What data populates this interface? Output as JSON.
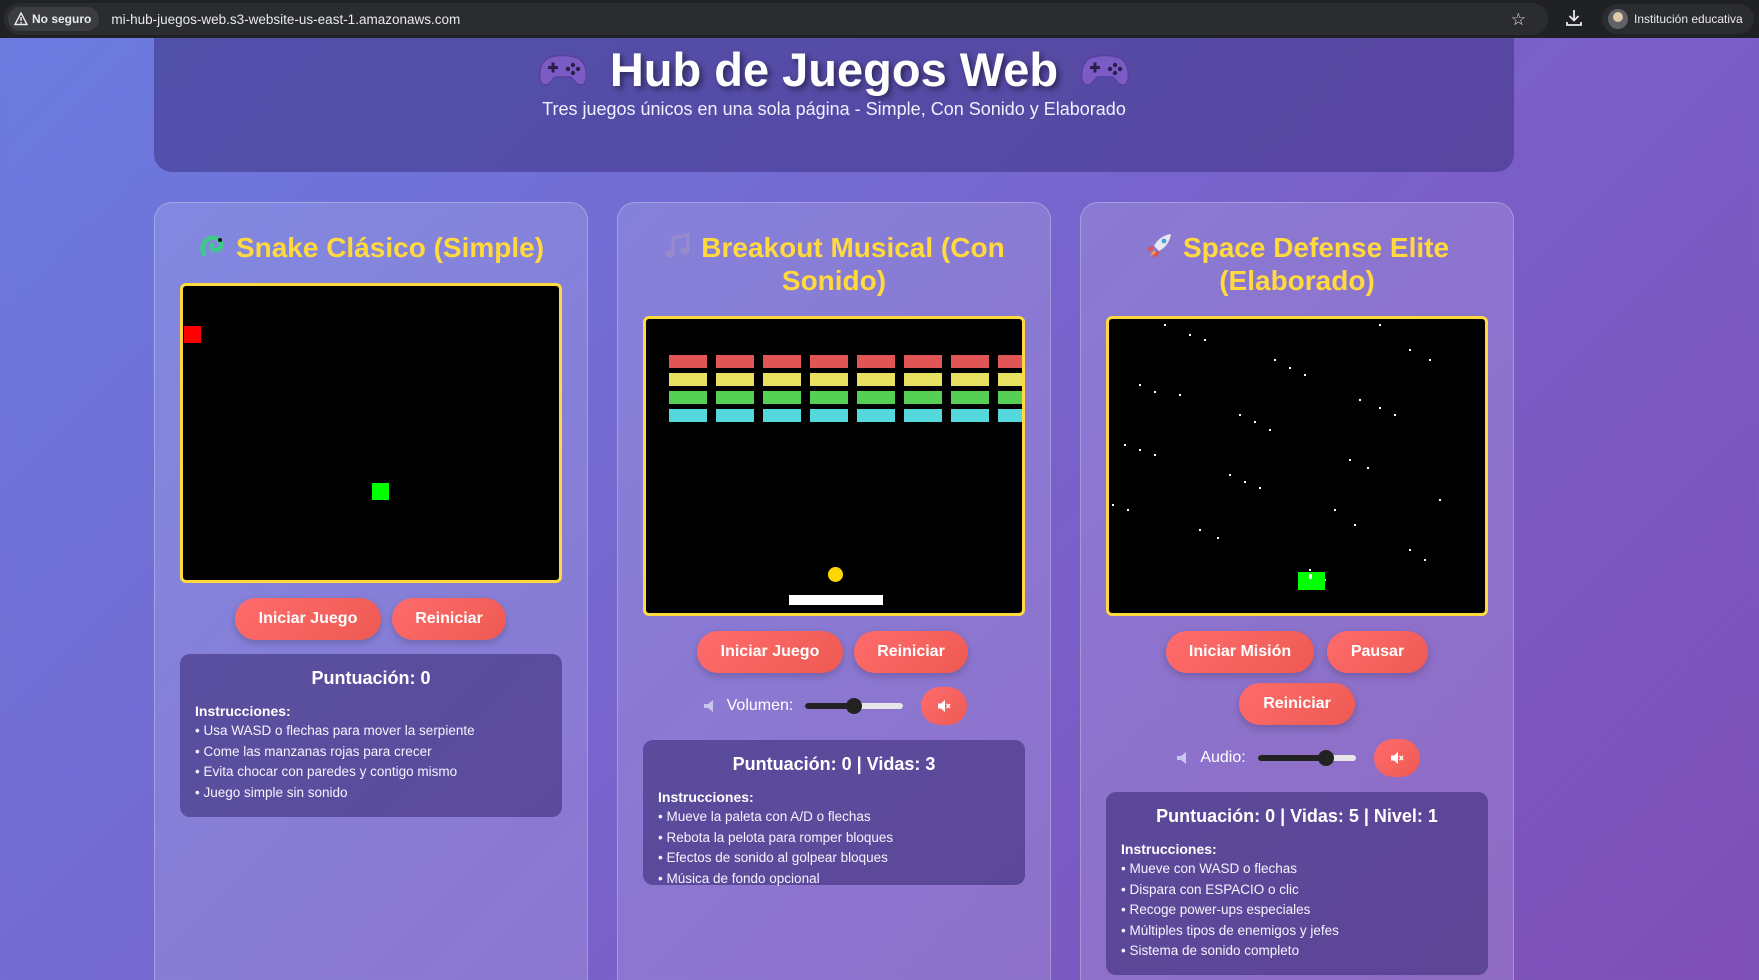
{
  "browser": {
    "security_label": "No seguro",
    "url": "mi-hub-juegos-web.s3-website-us-east-1.amazonaws.com",
    "profile_label": "Institución educativa"
  },
  "header": {
    "title": "Hub de Juegos Web",
    "subtitle": "Tres juegos únicos en una sola página - Simple, Con Sonido y Elaborado"
  },
  "cards": [
    {
      "title": "Snake Clásico (Simple)",
      "icon": "snake-icon",
      "buttons": [
        "Iniciar Juego",
        "Reiniciar"
      ],
      "score": "Puntuación: 0",
      "instructions_head": "Instrucciones:",
      "instructions": [
        "• Usa WASD o flechas para mover la serpiente",
        "• Come las manzanas rojas para crecer",
        "• Evita chocar con paredes y contigo mismo",
        "• Juego simple sin sonido"
      ]
    },
    {
      "title": "Breakout Musical (Con Sonido)",
      "icon": "music-note-icon",
      "buttons": [
        "Iniciar Juego",
        "Reiniciar"
      ],
      "volume_label": "Volumen:",
      "volume_level": 0.5,
      "score": "Puntuación: 0 | Vidas: 3",
      "instructions_head": "Instrucciones:",
      "instructions": [
        "• Mueve la paleta con A/D o flechas",
        "• Rebota la pelota para romper bloques",
        "• Efectos de sonido al golpear bloques",
        "• Música de fondo opcional"
      ],
      "brick_colors": [
        "#e05555",
        "#e8e060",
        "#55d055",
        "#55d8dc"
      ]
    },
    {
      "title": "Space Defense Elite (Elaborado)",
      "icon": "rocket-icon",
      "buttons": [
        "Iniciar Misión",
        "Pausar",
        "Reiniciar"
      ],
      "volume_label": "Audio:",
      "volume_level": 0.7,
      "score": "Puntuación: 0 | Vidas: 5 | Nivel: 1",
      "instructions_head": "Instrucciones:",
      "instructions": [
        "• Mueve con WASD o flechas",
        "• Dispara con ESPACIO o clic",
        "• Recoge power-ups especiales",
        "• Múltiples tipos de enemigos y jefes",
        "• Sistema de sonido completo"
      ]
    }
  ],
  "colors": {
    "accent": "#ffd93d",
    "button": "#ff6b6b",
    "snake": "#00ff00",
    "apple": "#ff0000"
  }
}
